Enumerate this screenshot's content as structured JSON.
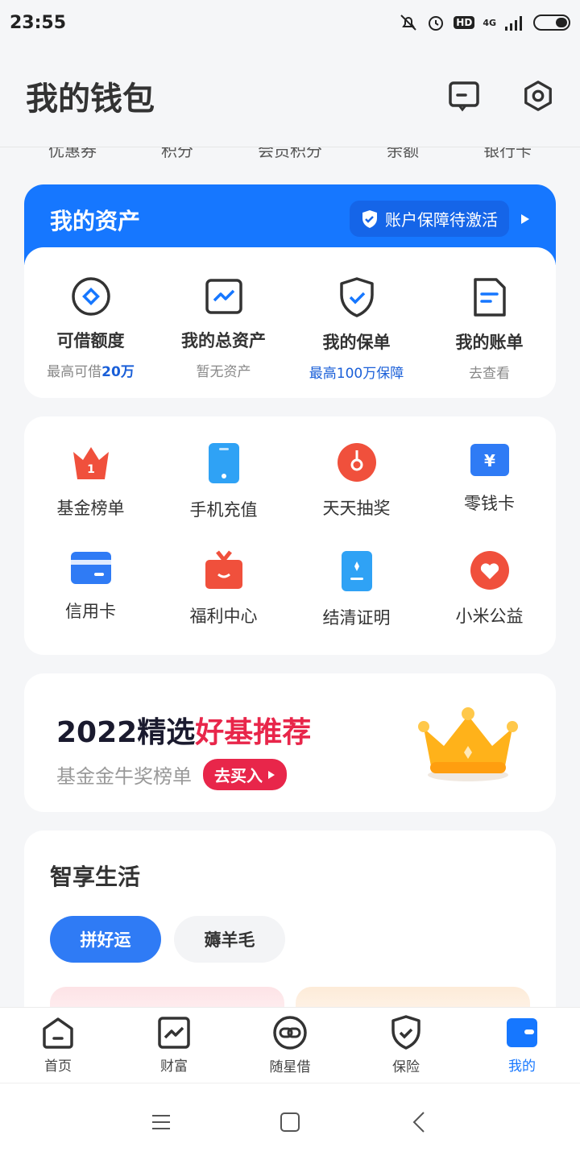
{
  "status": {
    "time": "23:55",
    "hd": "HD",
    "network": "4G"
  },
  "header": {
    "title": "我的钱包",
    "icons": [
      "message-icon",
      "settings-hexagon-icon"
    ]
  },
  "topmenu": [
    "优惠券",
    "积分",
    "会员积分",
    "余额",
    "银行卡"
  ],
  "assets": {
    "title": "我的资产",
    "protect_label": "账户保障待激活",
    "items": [
      {
        "icon": "loan-diamond-icon",
        "label": "可借额度",
        "sub_prefix": "最高可借",
        "sub_value": "20万"
      },
      {
        "icon": "asset-chart-icon",
        "label": "我的总资产",
        "sub": "暂无资产"
      },
      {
        "icon": "policy-shield-icon",
        "label": "我的保单",
        "sub": "最高100万保障"
      },
      {
        "icon": "bill-doc-icon",
        "label": "我的账单",
        "sub": "去查看"
      }
    ]
  },
  "services": [
    {
      "icon": "fund-rank-icon",
      "label": "基金榜单"
    },
    {
      "icon": "phone-recharge-icon",
      "label": "手机充值"
    },
    {
      "icon": "lottery-icon",
      "label": "天天抽奖"
    },
    {
      "icon": "change-card-icon",
      "label": "零钱卡"
    },
    {
      "icon": "credit-card-icon",
      "label": "信用卡"
    },
    {
      "icon": "gift-center-icon",
      "label": "福利中心"
    },
    {
      "icon": "settlement-cert-icon",
      "label": "结清证明"
    },
    {
      "icon": "charity-heart-icon",
      "label": "小米公益"
    }
  ],
  "promo": {
    "title_plain": "2022精选",
    "title_highlight": "好基推荐",
    "subtitle": "基金金牛奖榜单",
    "button": "去买入"
  },
  "life": {
    "title": "智享生活",
    "tabs": [
      {
        "label": "拼好运",
        "active": true
      },
      {
        "label": "薅羊毛",
        "active": false
      }
    ]
  },
  "tabbar": [
    {
      "icon": "home-icon",
      "label": "首页",
      "active": false
    },
    {
      "icon": "wealth-icon",
      "label": "财富",
      "active": false
    },
    {
      "icon": "loan-link-icon",
      "label": "随星借",
      "active": false
    },
    {
      "icon": "insurance-icon",
      "label": "保险",
      "active": false
    },
    {
      "icon": "wallet-icon",
      "label": "我的",
      "active": true
    }
  ],
  "colors": {
    "brand_blue": "#1677ff",
    "promo_red": "#e8264a",
    "tab_blue": "#2f7bf5"
  }
}
